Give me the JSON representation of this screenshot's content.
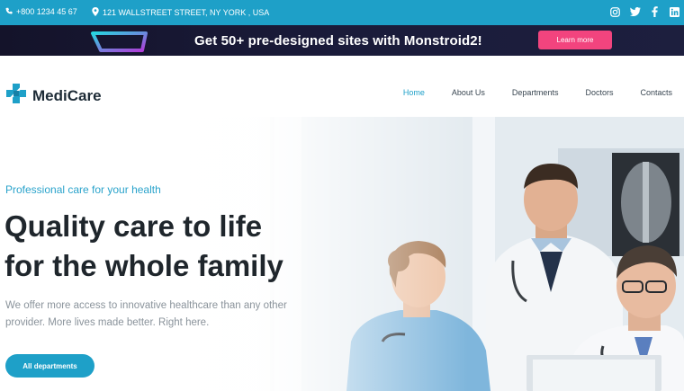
{
  "topbar": {
    "phone": "+800 1234 45 67",
    "address": "121 WALLSTREET STREET, NY YORK , USA",
    "social_icons": [
      "instagram-icon",
      "twitter-icon",
      "facebook-icon",
      "linkedin-icon"
    ]
  },
  "promo": {
    "text": "Get 50+ pre-designed sites with Monstroid2!",
    "button_label": "Learn more"
  },
  "header": {
    "brand": "MediCare",
    "nav": [
      {
        "label": "Home",
        "active": true
      },
      {
        "label": "About Us",
        "active": false
      },
      {
        "label": "Departments",
        "active": false
      },
      {
        "label": "Doctors",
        "active": false
      },
      {
        "label": "Contacts",
        "active": false
      }
    ]
  },
  "hero": {
    "tagline": "Professional care for your health",
    "headline_line1": "Quality care to life",
    "headline_line2": "for the whole family",
    "description_line1": "We offer more access to innovative healthcare than any other",
    "description_line2": "provider. More lives made better. Right here.",
    "button_label": "All departments"
  },
  "colors": {
    "accent": "#1ea0c8",
    "promo_button": "#f2447e",
    "heading": "#1f262c"
  }
}
